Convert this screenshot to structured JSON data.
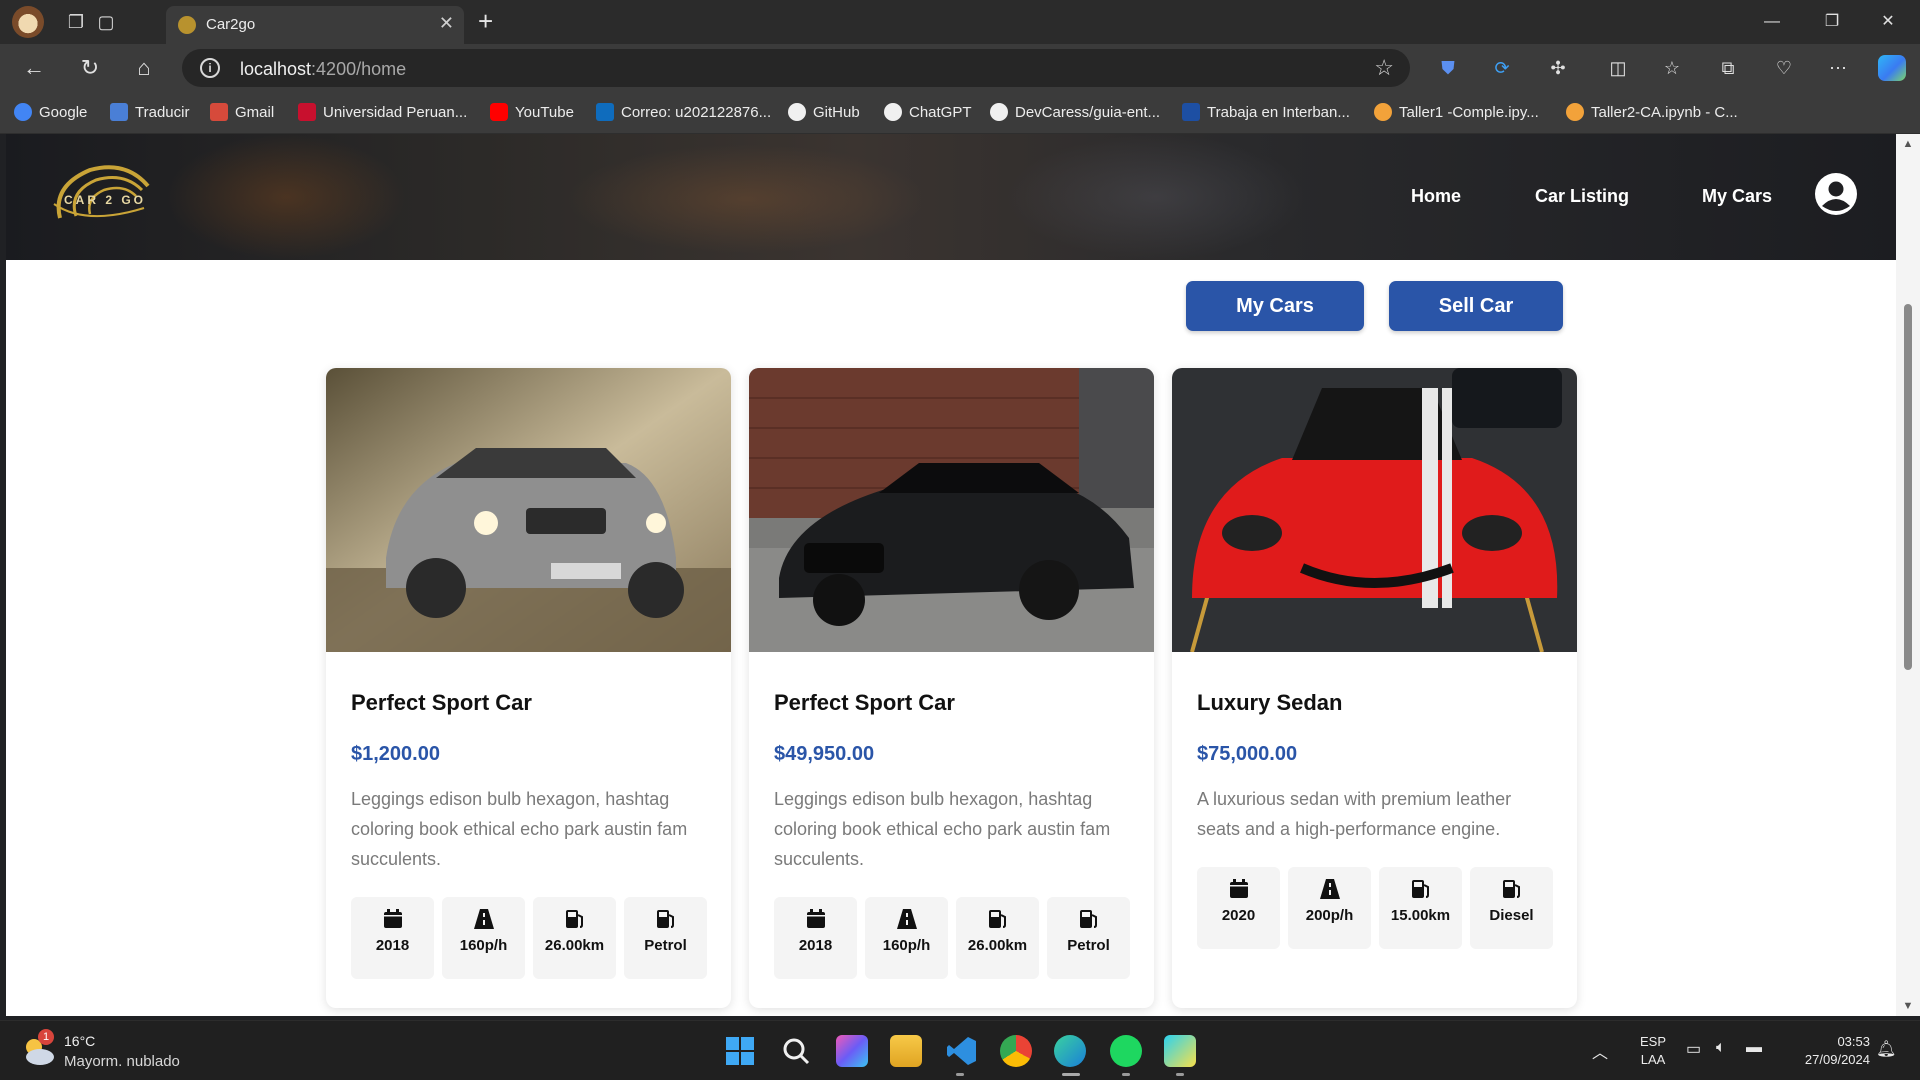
{
  "browser": {
    "tab_title": "Car2go",
    "url_host": "localhost",
    "url_rest": ":4200/home",
    "bookmarks": [
      {
        "label": "Google",
        "color": "#4285f4"
      },
      {
        "label": "Traducir",
        "color": "#4a7fd6"
      },
      {
        "label": "Gmail",
        "color": "#d64a3b"
      },
      {
        "label": "Universidad Peruan...",
        "color": "#c8102e"
      },
      {
        "label": "YouTube",
        "color": "#ff0000"
      },
      {
        "label": "Correo: u202122876...",
        "color": "#0f6cbd"
      },
      {
        "label": "GitHub",
        "color": "#f0f0f0"
      },
      {
        "label": "ChatGPT",
        "color": "#f0f0f0"
      },
      {
        "label": "DevCaress/guia-ent...",
        "color": "#f0f0f0"
      },
      {
        "label": "Trabaja en Interban...",
        "color": "#1d4fa3"
      },
      {
        "label": "Taller1 -Comple.ipy...",
        "color": "#f2a23a"
      },
      {
        "label": "Taller2-CA.ipynb - C...",
        "color": "#f2a23a"
      }
    ]
  },
  "site": {
    "logo_text": "CAR 2 GO",
    "nav": [
      {
        "label": "Home"
      },
      {
        "label": "Car Listing"
      },
      {
        "label": "My Cars"
      }
    ],
    "buttons": {
      "my_cars": "My Cars",
      "sell_car": "Sell Car"
    }
  },
  "cars": [
    {
      "title": "Perfect Sport Car",
      "price": "$1,200.00",
      "description": "Leggings edison bulb hexagon, hashtag coloring book ethical echo park austin fam succulents.",
      "year": "2018",
      "speed": "160p/h",
      "mileage": "26.00km",
      "fuel": "Petrol",
      "image": "silver-suv-photo"
    },
    {
      "title": "Perfect Sport Car",
      "price": "$49,950.00",
      "description": "Leggings edison bulb hexagon, hashtag coloring book ethical echo park austin fam succulents.",
      "year": "2018",
      "speed": "160p/h",
      "mileage": "26.00km",
      "fuel": "Petrol",
      "image": "black-sedan-photo"
    },
    {
      "title": "Luxury Sedan",
      "price": "$75,000.00",
      "description": "A luxurious sedan with premium leather seats and a high-performance engine.",
      "year": "2020",
      "speed": "200p/h",
      "mileage": "15.00km",
      "fuel": "Diesel",
      "image": "red-sports-car-photo"
    }
  ],
  "taskbar": {
    "weather_badge": "1",
    "temperature": "16°C",
    "weather": "Mayorm. nublado",
    "lang_top": "ESP",
    "lang_bottom": "LAA",
    "time": "03:53",
    "date": "27/09/2024"
  },
  "colors": {
    "accent": "#2a55a8",
    "header_dark": "#1c1d21"
  }
}
